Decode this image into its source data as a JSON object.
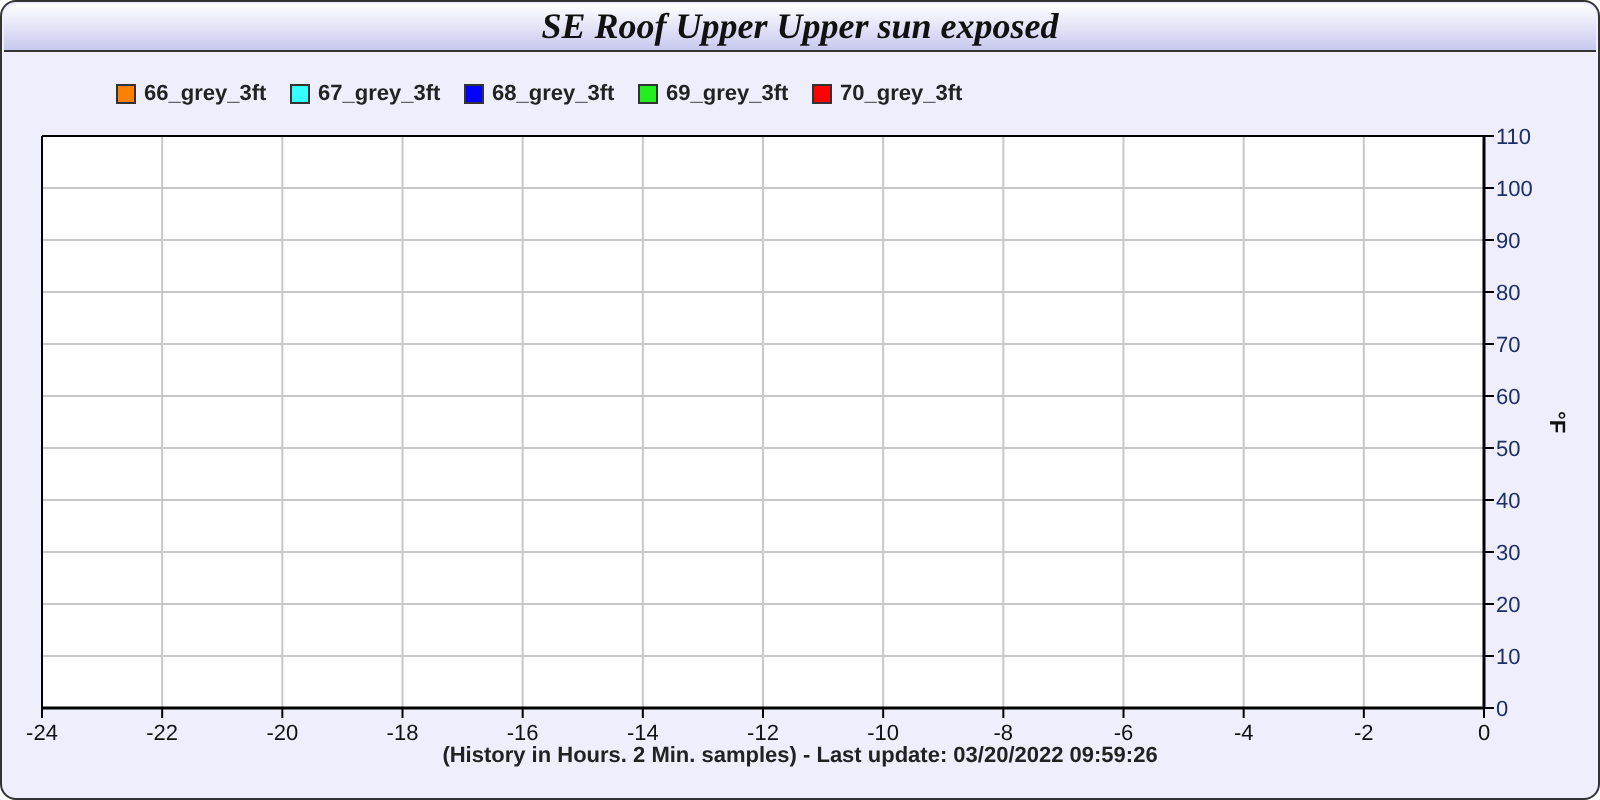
{
  "title": "SE Roof Upper Upper sun exposed",
  "chart": {
    "chart_data": {
      "type": "line",
      "xlabel": "(History in Hours. 2 Min. samples) - Last update: 03/20/2022 09:59:26",
      "ylabel": "°F",
      "grid": true,
      "categories": [
        "-24",
        "-22",
        "-20",
        "-18",
        "-16",
        "-14",
        "-12",
        "-10",
        "-8",
        "-6",
        "-4",
        "-2",
        "0"
      ],
      "series": [
        {
          "name": "66_grey_3ft",
          "color": "#ff8000",
          "values": [
            null,
            null,
            null,
            null,
            null,
            null,
            null,
            null,
            null,
            null,
            null,
            null,
            null
          ]
        },
        {
          "name": "67_grey_3ft",
          "color": "#33ffff",
          "values": [
            null,
            null,
            null,
            null,
            null,
            null,
            null,
            null,
            null,
            null,
            null,
            null,
            null
          ]
        },
        {
          "name": "68_grey_3ft",
          "color": "#0000ff",
          "values": [
            null,
            null,
            null,
            null,
            null,
            null,
            null,
            null,
            null,
            null,
            null,
            null,
            null
          ]
        },
        {
          "name": "69_grey_3ft",
          "color": "#22ee22",
          "values": [
            null,
            null,
            null,
            null,
            null,
            null,
            null,
            null,
            null,
            null,
            null,
            null,
            null
          ]
        },
        {
          "name": "70_grey_3ft",
          "color": "#ff0000",
          "values": [
            null,
            null,
            null,
            null,
            null,
            null,
            null,
            null,
            null,
            null,
            null,
            null,
            null
          ]
        }
      ],
      "ylim": [
        0,
        110
      ],
      "yticks": [
        0,
        10,
        20,
        30,
        40,
        50,
        60,
        70,
        80,
        90,
        100,
        110
      ]
    }
  }
}
